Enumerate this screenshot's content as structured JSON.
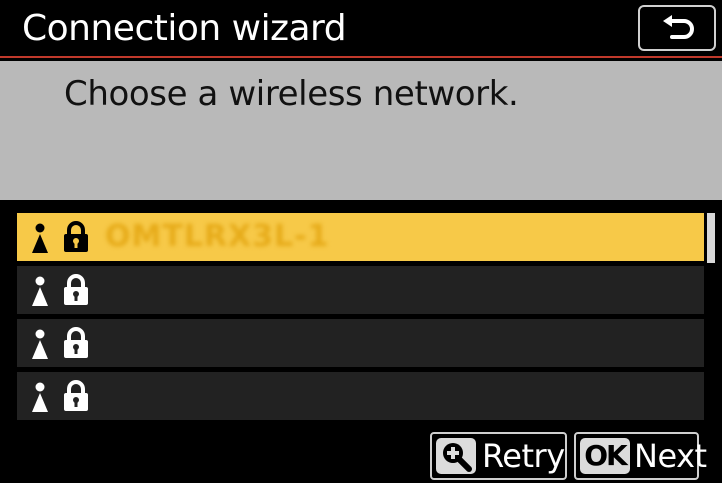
{
  "header": {
    "title": "Connection wizard",
    "back_icon": "back-arrow-icon"
  },
  "prompt": {
    "text": "Choose a wireless network."
  },
  "networks": [
    {
      "ssid": "OMTLRX3L-1",
      "selected": true,
      "icons": [
        "person-icon",
        "lock-icon"
      ]
    },
    {
      "ssid": "",
      "selected": false,
      "icons": [
        "person-icon",
        "lock-icon"
      ]
    },
    {
      "ssid": "",
      "selected": false,
      "icons": [
        "person-icon",
        "lock-icon"
      ]
    },
    {
      "ssid": "",
      "selected": false,
      "icons": [
        "person-icon",
        "lock-icon"
      ]
    }
  ],
  "footer": {
    "retry": {
      "badge_icon": "zoom-in-icon",
      "label": "Retry"
    },
    "next": {
      "badge": "OK",
      "label": "Next"
    }
  },
  "colors": {
    "accent_rule": "#c0392b",
    "selected_row": "#f7c948",
    "row": "#222222",
    "prompt_panel": "#b9b9b9"
  }
}
